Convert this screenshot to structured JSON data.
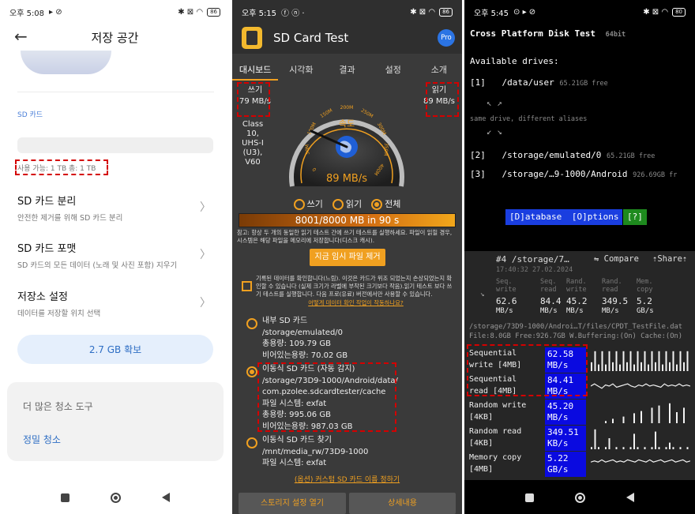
{
  "panel1": {
    "status": {
      "time": "오후 5:08",
      "battery": "86"
    },
    "title": "저장 공간",
    "sd_label": "SD 카드",
    "availability": "사용 가능: 1 TB   총: 1 TB",
    "items": [
      {
        "title": "SD 카드 분리",
        "subtitle": "안전한 제거를 위해 SD 카드 분리"
      },
      {
        "title": "SD 카드 포맷",
        "subtitle": "SD 카드의 모든 데이터 (노래 및 사진 포함) 지우기"
      },
      {
        "title": "저장소 설정",
        "subtitle": "데이터를 저장할 위치 선택"
      }
    ],
    "free_button": "2.7 GB 확보",
    "more_tools": "더 많은 청소 도구",
    "deep_clean": "정밀 청소"
  },
  "panel2": {
    "status": {
      "time": "오후 5:15",
      "battery": "86"
    },
    "app_title": "SD Card Test",
    "pro": "Pro",
    "tabs": [
      "대시보드",
      "시각화",
      "결과",
      "설정",
      "소개"
    ],
    "write_label": "쓰기",
    "write_value": "79 MB/s",
    "read_label": "읽기",
    "read_value": "89 MB/s",
    "card_class": [
      "Class",
      "10,",
      "UHS-I",
      "(U3),",
      "V60"
    ],
    "gauge_label": "속도",
    "gauge_value": "89 MB/s",
    "gauge_ticks": [
      "0",
      "50M",
      "100M",
      "150M",
      "200M",
      "250M",
      "300M",
      "350M",
      "400M"
    ],
    "radio_write": "쓰기",
    "radio_read": "읽기",
    "radio_all": "전체",
    "progress_text": "8001/8000 MB in 90 s",
    "progress_fraction": 1.0,
    "note": "참고: 항상 두 개의 동일한 읽기 테스트 간에 쓰기 테스트를 실행하세요. 파일이 읽힐 경우, 시스템은 해당 파일을 메모리에 저장합니다(디스크 캐시).",
    "remove_temp_button": "지금 임시 파일 제거",
    "verify_text": "기록된 데이터를 확인합니다(느림). 이것은 카드가 위조 되었는지 손상되었는지 확인할 수 있습니다 (실제 크기가 라벨에 부착된 크기보다 작음).읽기 테스트 보다 쓰기 테스트를 실행합니다. 다음 프로(유료) 버전에서만 사용할 수 있습니다.",
    "verify_link": "어떻게 데이터 확인 작업이 작동하나요?",
    "options": [
      {
        "selected": false,
        "lines": [
          "내부 SD 카드",
          "/storage/emulated/0",
          "총용량: 109.79 GB",
          "비어있는용량: 70.02 GB"
        ]
      },
      {
        "selected": true,
        "lines": [
          "이동식 SD 카드 (자동 감지)",
          "/storage/73D9-1000/Android/data/",
          "com.pzolee.sdcardtester/cache",
          "파일 시스템: exfat",
          "총용량: 995.06 GB",
          "비어있는용량: 987.03 GB"
        ]
      },
      {
        "selected": false,
        "lines": [
          "이동식 SD 카드 찾기",
          "/mnt/media_rw/73D9-1000",
          "파일 시스템: exfat"
        ]
      }
    ],
    "custom_name": "(옵션) 커스텀 SD 카드 이름 정하기",
    "open_settings": "스토리지 설정 열기",
    "details": "상세내용"
  },
  "panel3": {
    "status": {
      "time": "오후 5:45",
      "battery": "80"
    },
    "app_title": "Cross Platform Disk Test",
    "bits": "64bit",
    "available": "Available drives:",
    "drives": [
      {
        "num": "[1]",
        "path": "/data/user",
        "free": "65.21GB free"
      },
      {
        "num": "[2]",
        "path": "/storage/emulated/0",
        "free": "65.21GB free"
      },
      {
        "num": "[3]",
        "path": "/storage/…9-1000/Android",
        "free": "926.69GB fr"
      }
    ],
    "alias_note": "same drive, different aliases",
    "menu_database": "[D]atabase",
    "menu_options": "[O]ptions",
    "menu_help": "[?]",
    "result_title": "#4 /storage/7…",
    "compare": "⇋ Compare",
    "share": "⇡Share⇡",
    "timestamp": "17:40:32 27.02.2024",
    "stats": [
      {
        "label": [
          "Seq.",
          "write"
        ],
        "value": [
          "62.6",
          "MB/s"
        ]
      },
      {
        "label": [
          "Seq.",
          "read"
        ],
        "value": [
          "84.4",
          "MB/s"
        ]
      },
      {
        "label": [
          "Rand.",
          "write"
        ],
        "value": [
          "45.2",
          "MB/s"
        ]
      },
      {
        "label": [
          "Rand.",
          "read"
        ],
        "value": [
          "349.5",
          "MB/s"
        ]
      },
      {
        "label": [
          "Mem.",
          "copy"
        ],
        "value": [
          "5.2",
          "GB/s"
        ]
      }
    ],
    "file_line": "/storage/73D9-1000/Androi…T/files/CPDT_TestFile.dat",
    "config_line": "File:8.0GB Free:926.7GB W.Buffering:(On) Cache:(On)",
    "results": [
      {
        "label": [
          "Sequential",
          "write [4MB]"
        ],
        "value": [
          "62.58",
          "MB/s"
        ]
      },
      {
        "label": [
          "Sequential",
          "read [4MB]"
        ],
        "value": [
          "84.41",
          "MB/s"
        ]
      },
      {
        "label": [
          "Random write",
          "[4KB]"
        ],
        "value": [
          "45.20",
          "MB/s"
        ]
      },
      {
        "label": [
          "Random read",
          "[4KB]"
        ],
        "value": [
          "349.51",
          "KB/s"
        ]
      },
      {
        "label": [
          "Memory copy",
          "[4MB]"
        ],
        "value": [
          "5.22",
          "GB/s"
        ]
      }
    ],
    "colors": {
      "menu_blue": "#1a3ee0",
      "menu_green": "#1e8a1e",
      "value_blue": "#0a0ae0"
    }
  }
}
